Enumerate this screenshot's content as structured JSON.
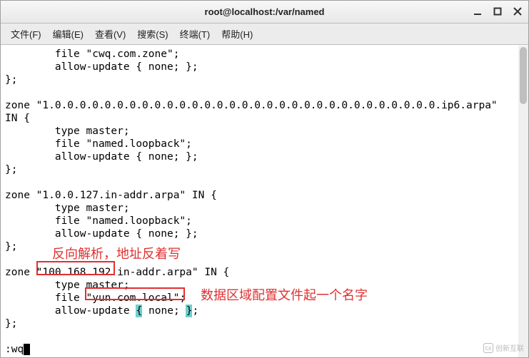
{
  "window": {
    "title": "root@localhost:/var/named"
  },
  "menu": {
    "file": "文件(F)",
    "edit": "编辑(E)",
    "view": "查看(V)",
    "search": "搜索(S)",
    "terminal": "终端(T)",
    "help": "帮助(H)"
  },
  "lines": {
    "l1": "        file \"cwq.com.zone\";",
    "l2": "        allow-update { none; };",
    "l3": "};",
    "l4": "",
    "l5": "zone \"1.0.0.0.0.0.0.0.0.0.0.0.0.0.0.0.0.0.0.0.0.0.0.0.0.0.0.0.0.0.0.0.ip6.arpa\"",
    "l6": "IN {",
    "l7": "        type master;",
    "l8": "        file \"named.loopback\";",
    "l9": "        allow-update { none; };",
    "l10": "};",
    "l11": "",
    "l12": "zone \"1.0.0.127.in-addr.arpa\" IN {",
    "l13": "        type master;",
    "l14": "        file \"named.loopback\";",
    "l15": "        allow-update { none; };",
    "l16": "};",
    "l17": "",
    "l18": "zone \"100.168.192.in-addr.arpa\" IN {",
    "l19": "        type master;",
    "l20a": "        file \"",
    "l20b": "yun.com.local",
    "l20c": "\";",
    "l21a": "        allow-update ",
    "l21b": "{",
    "l21c": " none; ",
    "l21d": "}",
    "l21e": ";",
    "l22": "};",
    "l23a": ":wq"
  },
  "annotations": {
    "a1": "反向解析，地址反着写",
    "a2": "数据区域配置文件起一个名字"
  },
  "watermark": {
    "logo": "cx",
    "text": "创新互联"
  }
}
